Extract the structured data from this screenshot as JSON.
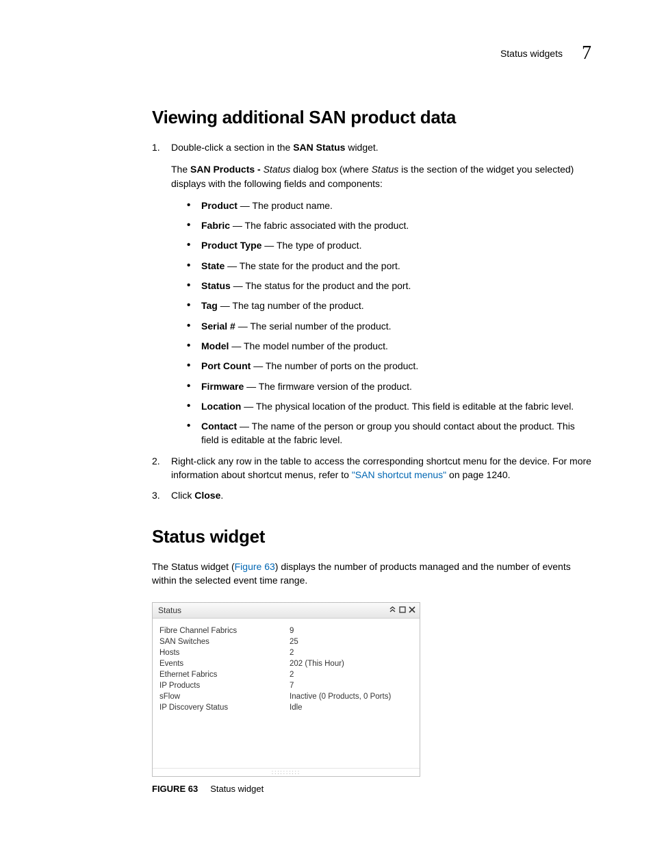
{
  "header": {
    "section": "Status widgets",
    "chapter_num": "7"
  },
  "s1": {
    "title": "Viewing additional SAN product data",
    "step1_pre": "Double-click a section in the ",
    "step1_b": "SAN Status",
    "step1_post": " widget.",
    "fup_pre": "The ",
    "fup_b": "SAN Products - ",
    "fup_i": "Status",
    "fup_mid": " dialog box (where ",
    "fup_i2": "Status",
    "fup_post": " is the section of the widget you selected) displays with the following fields and components:",
    "defs": [
      {
        "t": "Product",
        "d": " — The product name."
      },
      {
        "t": "Fabric",
        "d": " — The fabric associated with the product."
      },
      {
        "t": "Product Type",
        "d": " — The type of product."
      },
      {
        "t": "State",
        "d": " — The state for the product and the port."
      },
      {
        "t": "Status",
        "d": " — The status for the product and the port."
      },
      {
        "t": "Tag",
        "d": " — The tag number of the product."
      },
      {
        "t": "Serial #",
        "d": " — The serial number of the product."
      },
      {
        "t": "Model",
        "d": " — The model number of the product."
      },
      {
        "t": "Port Count",
        "d": " — The number of ports on the product."
      },
      {
        "t": "Firmware",
        "d": " — The firmware version of the product."
      },
      {
        "t": "Location",
        "d": " — The physical location of the product. This field is editable at the fabric level."
      },
      {
        "t": "Contact",
        "d": " — The name of the person or group you should contact about the product. This field is editable at the fabric level."
      }
    ],
    "step2_pre": "Right-click any row in the table to access the corresponding shortcut menu for the device. For more information about shortcut menus, refer to ",
    "step2_link": "\"SAN shortcut menus\"",
    "step2_post": " on page 1240.",
    "step3_pre": "Click ",
    "step3_b": "Close",
    "step3_post": "."
  },
  "s2": {
    "title": "Status widget",
    "intro_pre": "The Status widget (",
    "intro_link": "Figure 63",
    "intro_post": ") displays the number of products managed and the number of events within the selected event time range."
  },
  "widget": {
    "title": "Status",
    "rows": [
      {
        "k": "Fibre Channel Fabrics",
        "v": "9"
      },
      {
        "k": "SAN Switches",
        "v": "25"
      },
      {
        "k": "Hosts",
        "v": "2"
      },
      {
        "k": "Events",
        "v": "202 (This Hour)"
      },
      {
        "k": "Ethernet Fabrics",
        "v": "2"
      },
      {
        "k": "IP Products",
        "v": "7"
      },
      {
        "k": "sFlow",
        "v": "Inactive (0 Products, 0 Ports)"
      },
      {
        "k": "IP Discovery Status",
        "v": "Idle"
      }
    ]
  },
  "figure": {
    "label": "FIGURE 63",
    "caption": "Status widget"
  }
}
